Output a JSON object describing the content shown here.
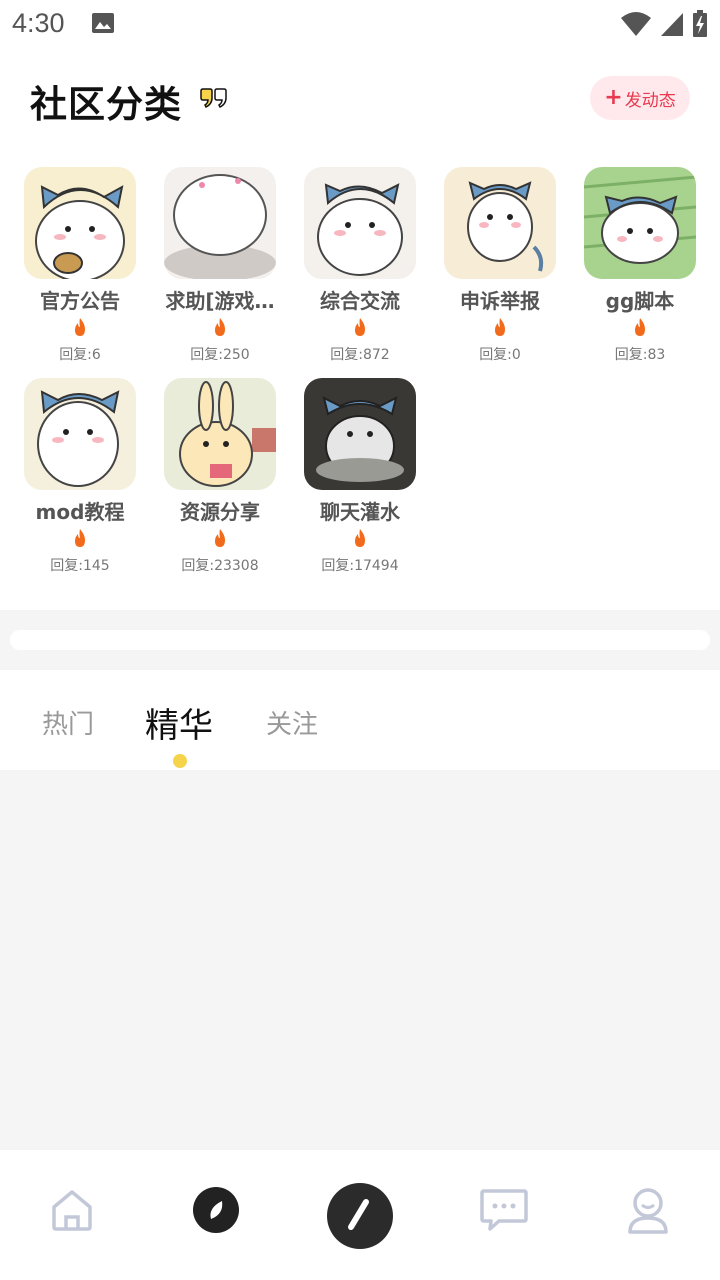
{
  "status": {
    "time": "4:30"
  },
  "header": {
    "title": "社区分类",
    "post_button": "发动态",
    "post_plus": "+"
  },
  "categories": [
    {
      "name": "官方公告",
      "replies": "回复:6"
    },
    {
      "name": "求助[游戏…",
      "replies": "回复:250"
    },
    {
      "name": "综合交流",
      "replies": "回复:872"
    },
    {
      "name": "申诉举报",
      "replies": "回复:0"
    },
    {
      "name": "gg脚本",
      "replies": "回复:83"
    },
    {
      "name": "mod教程",
      "replies": "回复:145"
    },
    {
      "name": "资源分享",
      "replies": "回复:23308"
    },
    {
      "name": "聊天灌水",
      "replies": "回复:17494"
    }
  ],
  "tabs": [
    {
      "label": "热门"
    },
    {
      "label": "精华"
    },
    {
      "label": "关注"
    }
  ],
  "active_tab": "精华",
  "nav": [
    "home-icon",
    "discover-icon",
    "compose-icon",
    "messages-icon",
    "profile-icon"
  ],
  "colors": {
    "accent": "#e8394f",
    "tab_dot": "#f5d34a",
    "brand_dark": "#222222"
  }
}
